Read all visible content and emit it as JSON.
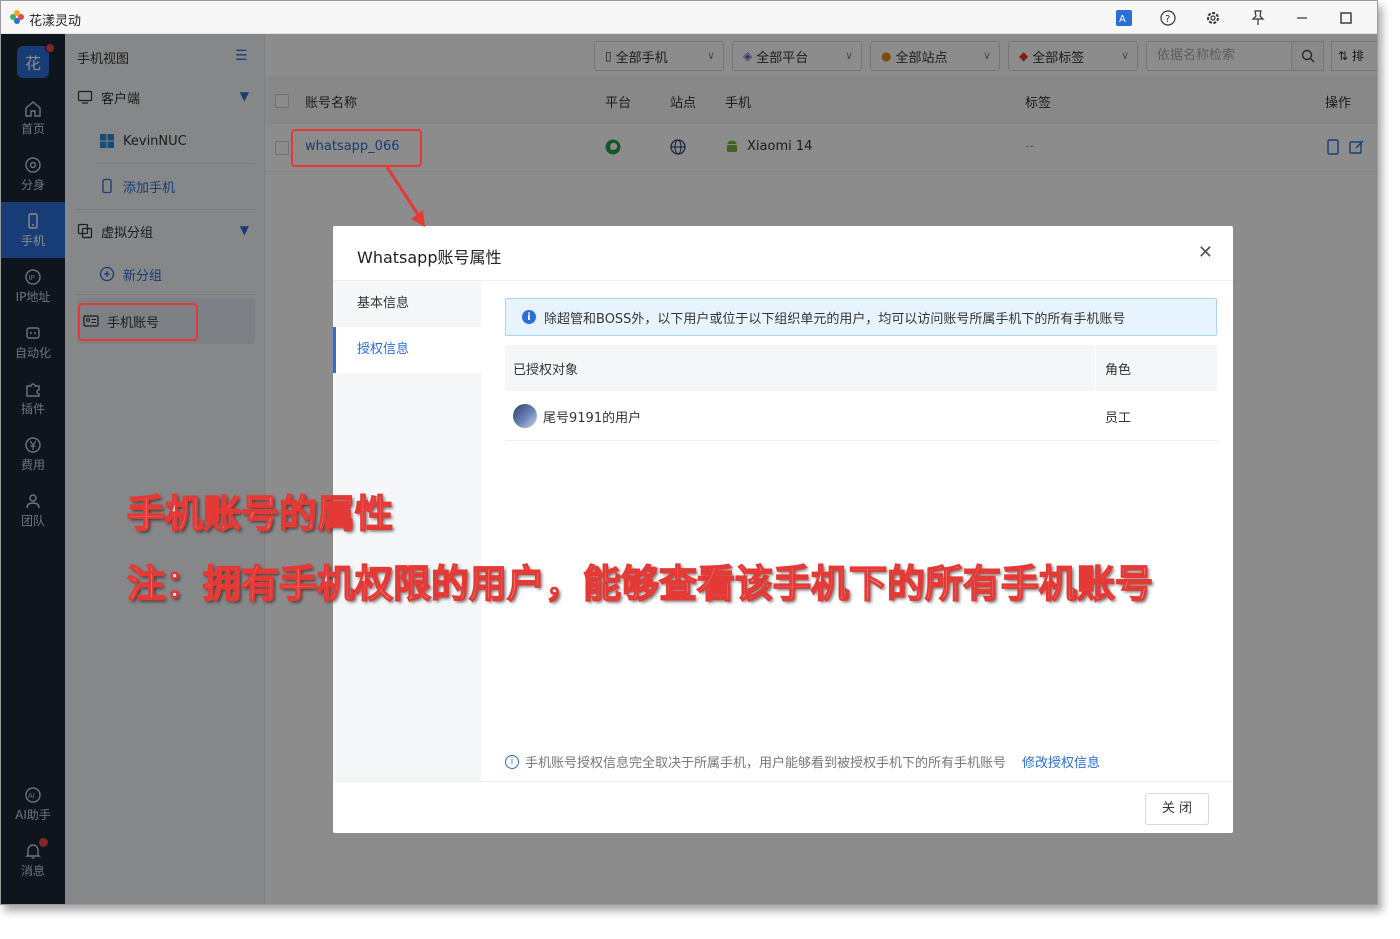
{
  "window": {
    "title": "花漾灵动",
    "buttons": [
      "translate-icon",
      "help-icon",
      "settings-icon",
      "pin-icon",
      "minimize-icon",
      "maximize-icon",
      "close-icon"
    ]
  },
  "rail": {
    "brand": "花",
    "items": [
      {
        "label": "首页",
        "icon": "home-icon"
      },
      {
        "label": "分身",
        "icon": "chrome-icon"
      },
      {
        "label": "手机",
        "icon": "phone-icon"
      },
      {
        "label": "IP地址",
        "icon": "ip-icon"
      },
      {
        "label": "自动化",
        "icon": "robot-icon"
      },
      {
        "label": "插件",
        "icon": "puzzle-icon"
      },
      {
        "label": "费用",
        "icon": "yen-icon"
      },
      {
        "label": "团队",
        "icon": "team-icon"
      }
    ],
    "bottom": [
      {
        "label": "AI助手",
        "icon": "ai-icon"
      },
      {
        "label": "消息",
        "icon": "bell-icon"
      }
    ]
  },
  "sidebar": {
    "header": "手机视图",
    "client": "客户端",
    "device": "KevinNUC",
    "add_phone": "添加手机",
    "virtual_group": "虚拟分组",
    "new_group": "新分组",
    "phone_accounts": "手机账号"
  },
  "filters": {
    "phones": "全部手机",
    "platforms": "全部平台",
    "sites": "全部站点",
    "tags": "全部标签",
    "search_placeholder": "依据名称检索",
    "sort": "⇅ 排"
  },
  "table": {
    "headers": {
      "name": "账号名称",
      "platform": "平台",
      "site": "站点",
      "phone": "手机",
      "tags": "标签",
      "ops": "操作"
    },
    "rows": [
      {
        "name": "whatsapp_066",
        "phone": "Xiaomi 14",
        "tags": "--"
      }
    ]
  },
  "dialog": {
    "title": "Whatsapp账号属性",
    "tabs": [
      "基本信息",
      "授权信息"
    ],
    "notice": "除超管和BOSS外，以下用户或位于以下组织单元的用户，均可以访问账号所属手机下的所有手机账号",
    "auth_headers": {
      "target": "已授权对象",
      "role": "角色"
    },
    "auth_rows": [
      {
        "target": "尾号9191的用户",
        "role": "员工"
      }
    ],
    "footnote": "手机账号授权信息完全取决于所属手机，用户能够看到被授权手机下的所有手机账号",
    "edit_link": "修改授权信息",
    "close_button": "关 闭"
  },
  "annotation": {
    "line1": "手机账号的属性",
    "line2": "注：拥有手机权限的用户，能够查看该手机下的所有手机账号"
  },
  "colors": {
    "accent": "#2a6ed8",
    "rail": "#1d2736",
    "annotation": "#e53935"
  }
}
